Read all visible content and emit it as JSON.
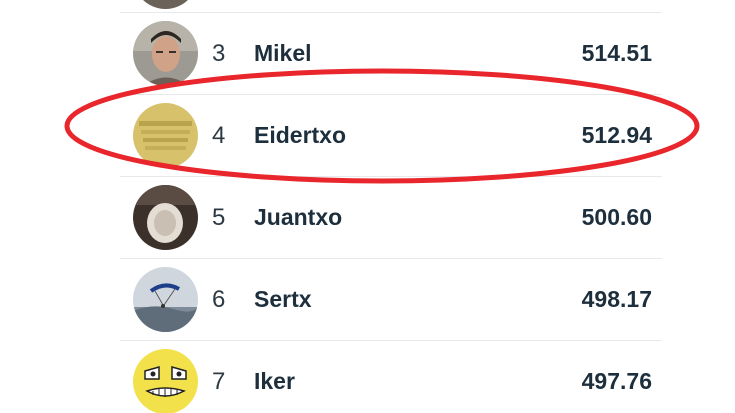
{
  "leaderboard": {
    "rows": [
      {
        "rank": "",
        "name": "",
        "score": "",
        "avatar": "dark-partial"
      },
      {
        "rank": "3",
        "name": "Mikel",
        "score": "514.51",
        "avatar": "man-portrait"
      },
      {
        "rank": "4",
        "name": "Eidertxo",
        "score": "512.94",
        "avatar": "yellow-sign"
      },
      {
        "rank": "5",
        "name": "Juantxo",
        "score": "500.60",
        "avatar": "toilet-photo"
      },
      {
        "rank": "6",
        "name": "Sertx",
        "score": "498.17",
        "avatar": "paraglider-photo"
      },
      {
        "rank": "7",
        "name": "Iker",
        "score": "497.76",
        "avatar": "yellow-face"
      }
    ],
    "highlighted_rank": "4",
    "highlight_color": "#e8262b"
  }
}
